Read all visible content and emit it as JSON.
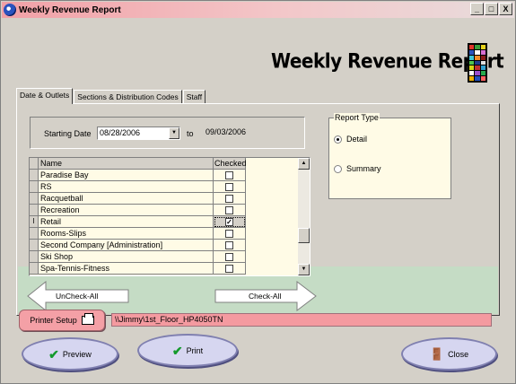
{
  "window": {
    "title": "Weekly Revenue Report",
    "controls": [
      "_",
      "□",
      "X"
    ]
  },
  "header": {
    "title": "Weekly Revenue Report"
  },
  "logo_colors": [
    "#e0352b",
    "#3a9c3a",
    "#e8d31d",
    "#2a52be",
    "#ffffff",
    "#d86fd0",
    "#3fc8d8",
    "#f28c28",
    "#8b1a1a",
    "#4fc34f",
    "#1d3b8c",
    "#e0e0e0",
    "#d6d613",
    "#c03030",
    "#30a0d0",
    "#ffffff",
    "#9b4fd0",
    "#28a84c",
    "#f0b000",
    "#2050c0",
    "#ff6060"
  ],
  "tabs": [
    {
      "label": "Date & Outlets",
      "active": true
    },
    {
      "label": "Sections & Distribution Codes",
      "active": false
    },
    {
      "label": "Staff",
      "active": false
    }
  ],
  "dates": {
    "starting_label": "Starting Date",
    "start_value": "08/28/2006",
    "to_label": "to",
    "end_value": "09/03/2006"
  },
  "report_type": {
    "legend": "Report Type",
    "options": [
      {
        "label": "Detail",
        "selected": true
      },
      {
        "label": "Summary",
        "selected": false
      }
    ]
  },
  "grid": {
    "columns": [
      "Name",
      "Checked"
    ],
    "rows": [
      {
        "name": "Paradise Bay",
        "checked": false,
        "current": false
      },
      {
        "name": "RS",
        "checked": false,
        "current": false
      },
      {
        "name": "Racquetball",
        "checked": false,
        "current": false
      },
      {
        "name": "Recreation",
        "checked": false,
        "current": false
      },
      {
        "name": "Retail",
        "checked": true,
        "current": true
      },
      {
        "name": "Rooms-Slips",
        "checked": false,
        "current": false
      },
      {
        "name": "Second Company [Administration]",
        "checked": false,
        "current": false
      },
      {
        "name": "Ski Shop",
        "checked": false,
        "current": false
      },
      {
        "name": "Spa-Tennis-Fitness",
        "checked": false,
        "current": false
      }
    ],
    "current_marker": "I"
  },
  "buttons": {
    "uncheck_all": "UnCheck-All",
    "check_all": "Check-All",
    "printer_setup": "Printer Setup",
    "preview": "Preview",
    "print": "Print",
    "close": "Close"
  },
  "printer": {
    "path": "\\\\Jimmy\\1st_Floor_HP4050TN"
  }
}
